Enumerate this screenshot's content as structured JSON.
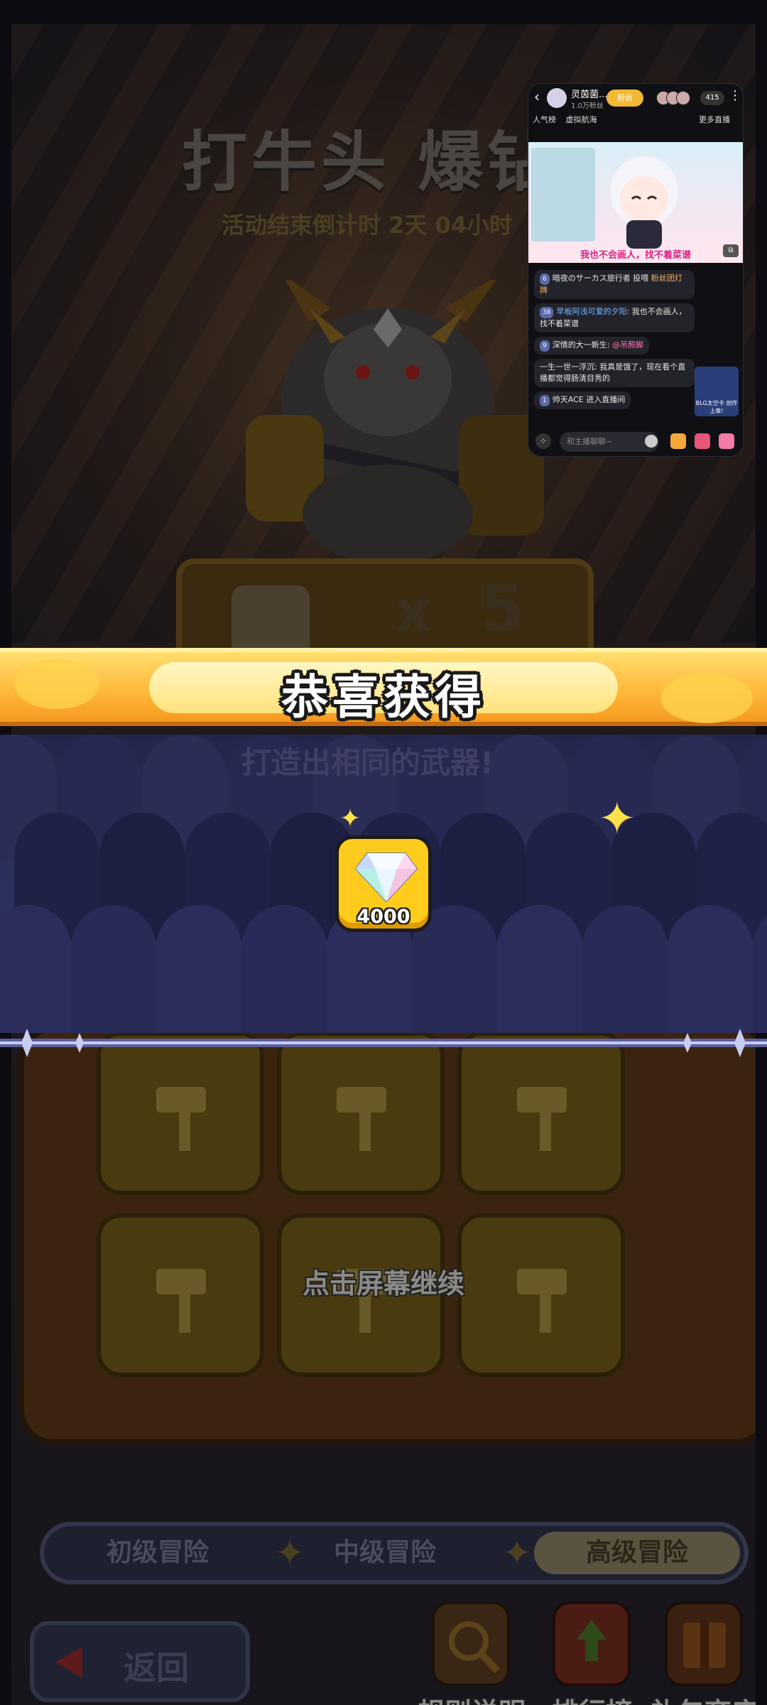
{
  "game": {
    "title": "打牛头 爆钻",
    "countdown": "活动结束倒计时 2天 04小时",
    "prize_times": "x",
    "prize_count": "5",
    "subtitle_faded": "打造出相同的武器!",
    "reward_banner": "恭喜获得",
    "reward_item": {
      "icon": "diamond-icon",
      "amount": "4000"
    },
    "continue_hint": "点击屏幕继续",
    "levels": [
      {
        "label": "初级冒险",
        "active": false
      },
      {
        "label": "中级冒险",
        "active": false
      },
      {
        "label": "高级冒险",
        "active": true
      }
    ],
    "back_label": "返回",
    "bottom_buttons": [
      {
        "label": "规则说明",
        "icon": "magnifier-icon"
      },
      {
        "label": "排行榜",
        "icon": "trophy-arrow-icon"
      },
      {
        "label": "礼包商店",
        "icon": "gift-scroll-icon"
      }
    ]
  },
  "live_window": {
    "streamer_name": "灵茵菌...",
    "fans": "1.0万粉丝",
    "follow_label": "粉丝",
    "viewer_count": "415",
    "tags": [
      "人气榜",
      "虚拟航海"
    ],
    "more_live": "更多直播",
    "video_caption": "我也不会画人，找不着菜谱",
    "chat": [
      {
        "level": "6",
        "user": "暗夜のサーカス旅行者",
        "text": "投喂",
        "gift": "粉丝团灯牌"
      },
      {
        "level": "38",
        "user": "早板阿浅可爱的夕阳",
        "text": "我也不会画人，找不着菜谱"
      },
      {
        "level": "9",
        "user": "深情的大一新生",
        "text": "@吊照脚"
      },
      {
        "level": "",
        "user": "一生一世一浮沉",
        "text": "我真是饿了，现在看个直播都觉得肠清目秀的"
      },
      {
        "level": "1",
        "user": "帅天ACE",
        "text": "进入直播间"
      }
    ],
    "promo_caption": "BLG太空卡 创作上章!",
    "input_placeholder": "和主播聊聊~"
  }
}
